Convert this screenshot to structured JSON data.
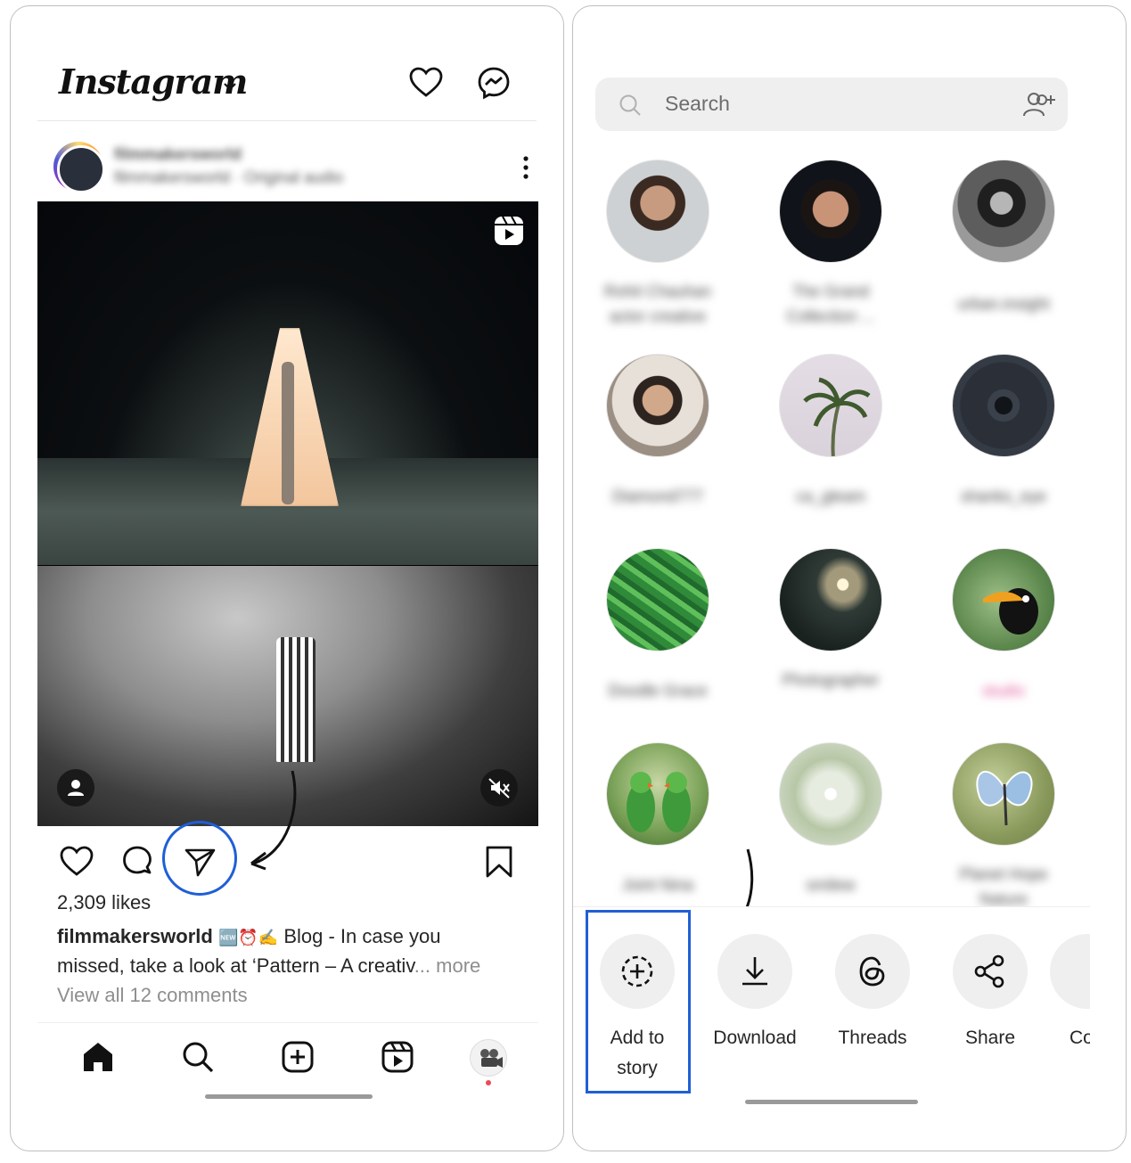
{
  "left_screen": {
    "header": {
      "logo_text": "Instagram"
    },
    "post": {
      "username": "filmmakersworld",
      "audio_line": "filmmakersworld · Original audio",
      "likes": "2,309 likes",
      "caption_user": "filmmakersworld",
      "caption_emojis": "🆕⏰✍️",
      "caption_text_1": "Blog - In case you",
      "caption_text_2": "missed, take a look at ‘Pattern – A creativ",
      "caption_more": "... more",
      "view_comments": "View all 12 comments"
    },
    "bottom_nav": [
      "home",
      "search",
      "create",
      "reels",
      "profile"
    ]
  },
  "right_screen": {
    "search": {
      "placeholder": "Search"
    },
    "contacts": [
      {
        "name_line1": "Rohit Chauhan",
        "name_line2": "actor creative",
        "photo": "portrait-man-1"
      },
      {
        "name_line1": "The Grand",
        "name_line2": "Collection ...",
        "photo": "portrait-man-2"
      },
      {
        "name_line1": "urban.insight",
        "name_line2": "",
        "photo": "photographer-camera"
      },
      {
        "name_line1": "Diamond777",
        "name_line2": "",
        "photo": "man-glasses"
      },
      {
        "name_line1": "ca_gleam",
        "name_line2": "",
        "photo": "palm-tree"
      },
      {
        "name_line1": "shanks_eye",
        "name_line2": "",
        "photo": "eye-closeup"
      },
      {
        "name_line1": "Doodle Grace",
        "name_line2": "",
        "photo": "green-leaves"
      },
      {
        "name_line1": "Photographer",
        "name_line2": "",
        "photo": "water-sparkle"
      },
      {
        "name_line1": "studio",
        "name_line2": "",
        "photo": "toucan"
      },
      {
        "name_line1": "Joint Nina",
        "name_line2": "",
        "photo": "parrots"
      },
      {
        "name_line1": "smilew",
        "name_line2": "",
        "photo": "white-flowers"
      },
      {
        "name_line1": "Planet Hope",
        "name_line2": "Nature",
        "photo": "butterfly"
      }
    ],
    "share_options": [
      {
        "label_line1": "Add to",
        "label_line2": "story",
        "icon": "add-story-icon"
      },
      {
        "label_line1": "Download",
        "label_line2": "",
        "icon": "download-icon"
      },
      {
        "label_line1": "Threads",
        "label_line2": "",
        "icon": "threads-icon"
      },
      {
        "label_line1": "Share",
        "label_line2": "",
        "icon": "share-icon"
      },
      {
        "label_line1": "Co",
        "label_line2": "",
        "icon": "copy-icon"
      }
    ]
  },
  "colors": {
    "highlight": "#1f5fd6",
    "notification_dot": "#ed4956"
  }
}
